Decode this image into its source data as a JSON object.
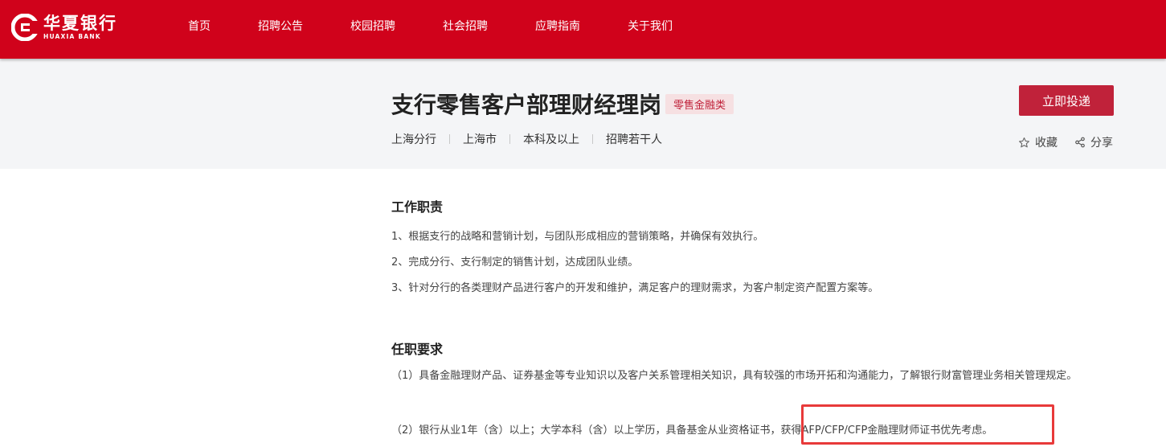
{
  "header": {
    "logo_cn": "华夏银行",
    "logo_en": "HUAXIA BANK",
    "nav": [
      "首页",
      "招聘公告",
      "校园招聘",
      "社会招聘",
      "应聘指南",
      "关于我们"
    ]
  },
  "job": {
    "title": "支行零售客户部理财经理岗",
    "tag": "零售金融类",
    "meta": [
      "上海分行",
      "上海市",
      "本科及以上",
      "招聘若干人"
    ],
    "apply_label": "立即投递",
    "collect_label": "收藏",
    "share_label": "分享"
  },
  "duties": {
    "title": "工作职责",
    "items": [
      "1、根据支行的战略和营销计划，与团队形成相应的营销策略，并确保有效执行。",
      "2、完成分行、支行制定的销售计划，达成团队业绩。",
      "3、针对分行的各类理财产品进行客户的开发和维护，满足客户的理财需求，为客户制定资产配置方案等。"
    ]
  },
  "requirements": {
    "title": "任职要求",
    "items": [
      "（1）具备金融理财产品、证券基金等专业知识以及客户关系管理相关知识，具有较强的市场开拓和沟通能力，了解银行财富管理业务相关管理规定。",
      "（2）银行从业1年（含）以上；大学本科（含）以上学历，具备基金从业资格证书，获得AFP/CFP/CFP金融理财师证书优先考虑。"
    ]
  },
  "colors": {
    "brand_red": "#d0021b",
    "button_red": "#c0223a",
    "highlight": "#e83a3a"
  }
}
